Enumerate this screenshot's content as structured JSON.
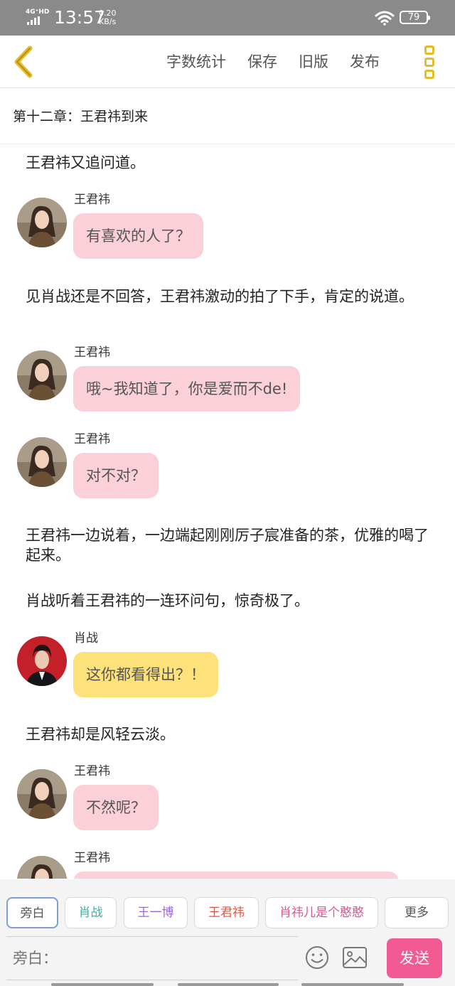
{
  "status": {
    "network": "4G⁺HD",
    "time": "13:57",
    "speed_value": "0.20",
    "speed_unit": "KB/s",
    "battery": "79"
  },
  "toolbar": {
    "word_count": "字数统计",
    "save": "保存",
    "old_version": "旧版",
    "publish": "发布"
  },
  "chapter": {
    "title": "第十二章：王君祎到来"
  },
  "content": {
    "n1": "王君祎又追问道。",
    "m1": {
      "speaker": "王君祎",
      "text": "有喜欢的人了？"
    },
    "n2": "见肖战还是不回答，王君祎激动的拍了下手，肯定的说道。",
    "m2": {
      "speaker": "王君祎",
      "text": "哦~我知道了，你是爱而不de!"
    },
    "m3": {
      "speaker": "王君祎",
      "text": "对不对？"
    },
    "n3": "王君祎一边说着，一边端起刚刚厉子宸准备的茶，优雅的喝了起来。",
    "n4": "肖战听着王君祎的一连环问句，惊奇极了。",
    "m4": {
      "speaker": "肖战",
      "text": "这你都看得出？！"
    },
    "n5": "王君祎却是风轻云淡。",
    "m5": {
      "speaker": "王君祎",
      "text": "不然呢？"
    },
    "m6": {
      "speaker": "王君祎",
      "text": ""
    }
  },
  "characters": {
    "narrator": "旁白",
    "xiao_zhan": "肖战",
    "wang_yibo": "王一博",
    "wang_junyi": "王君祎",
    "custom": "肖祎儿是个憨憨",
    "more": "更多"
  },
  "colors": {
    "narrator": "#555555",
    "xiao_zhan": "#3aaea8",
    "wang_yibo": "#9a6ad0",
    "wang_junyi": "#e05540",
    "custom": "#d9578f",
    "pink_bubble": "#fbd0d8",
    "yellow_bubble": "#fde17a",
    "send": "#f25a94",
    "accent": "#e5bd2a"
  },
  "input": {
    "placeholder": "旁白：",
    "send": "发送"
  },
  "icons": {
    "back": "chevron-left-icon",
    "menu": "menu-icon",
    "emoji": "smiley-icon",
    "image": "image-icon"
  }
}
